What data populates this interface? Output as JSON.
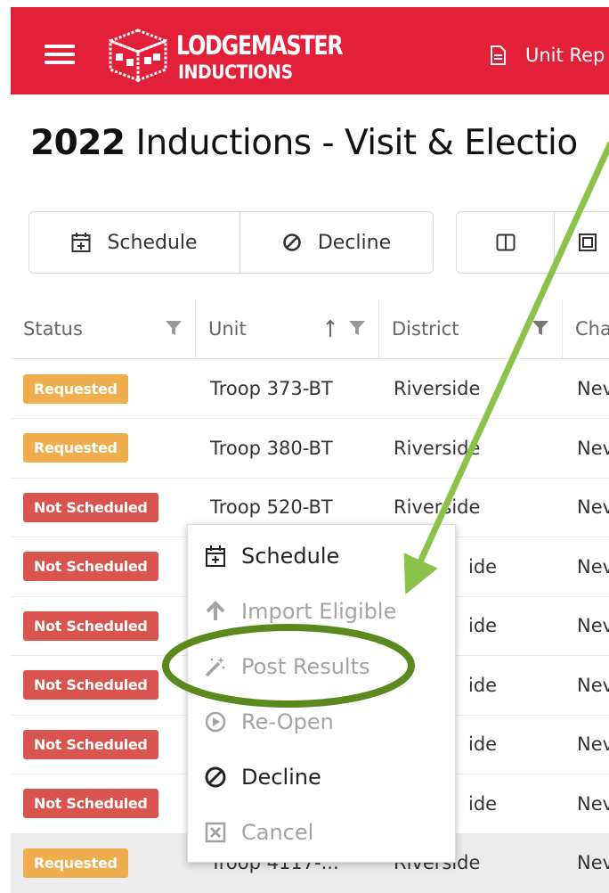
{
  "header": {
    "brand_main": "LODGEMASTER",
    "brand_sub": "INDUCTIONS",
    "report_link": "Unit Rep",
    "brand_color": "#e3203a"
  },
  "page": {
    "title_year": "2022",
    "title_rest": " Inductions - Visit & Electio"
  },
  "toolbar": {
    "schedule_label": "Schedule",
    "decline_label": "Decline"
  },
  "table": {
    "columns": [
      "Status",
      "Unit",
      "District",
      "Cha"
    ],
    "rows": [
      {
        "status": "Requested",
        "status_type": "req",
        "unit": "Troop 373-BT",
        "district": "Riverside",
        "charter": "Nev"
      },
      {
        "status": "Requested",
        "status_type": "req",
        "unit": "Troop 380-BT",
        "district": "Riverside",
        "charter": "Nev"
      },
      {
        "status": "Not Scheduled",
        "status_type": "ns",
        "unit": "Troop 520-BT",
        "district": "Riverside",
        "charter": "Nev"
      },
      {
        "status": "Not Scheduled",
        "status_type": "ns",
        "unit": "",
        "district": "ide",
        "charter": "Nev"
      },
      {
        "status": "Not Scheduled",
        "status_type": "ns",
        "unit": "",
        "district": "ide",
        "charter": "Nev"
      },
      {
        "status": "Not Scheduled",
        "status_type": "ns",
        "unit": "",
        "district": "ide",
        "charter": "Nev"
      },
      {
        "status": "Not Scheduled",
        "status_type": "ns",
        "unit": "",
        "district": "ide",
        "charter": "Nev"
      },
      {
        "status": "Not Scheduled",
        "status_type": "ns",
        "unit": "",
        "district": "ide",
        "charter": "Nev"
      },
      {
        "status": "Requested",
        "status_type": "req",
        "unit": "Troop 4117-...",
        "district": "Riverside",
        "charter": "Nev"
      }
    ]
  },
  "context_menu": {
    "items": [
      {
        "label": "Schedule",
        "enabled": true,
        "icon": "calendar-plus-icon"
      },
      {
        "label": "Import Eligible",
        "enabled": false,
        "icon": "arrow-up-icon"
      },
      {
        "label": "Post Results",
        "enabled": false,
        "icon": "magic-wand-icon"
      },
      {
        "label": "Re-Open",
        "enabled": false,
        "icon": "play-circle-icon"
      },
      {
        "label": "Decline",
        "enabled": true,
        "icon": "ban-icon"
      },
      {
        "label": "Cancel",
        "enabled": false,
        "icon": "x-square-icon"
      }
    ]
  },
  "annotation": {
    "arrow_color": "#8bc34a",
    "ellipse_color": "#5a8a1e"
  }
}
